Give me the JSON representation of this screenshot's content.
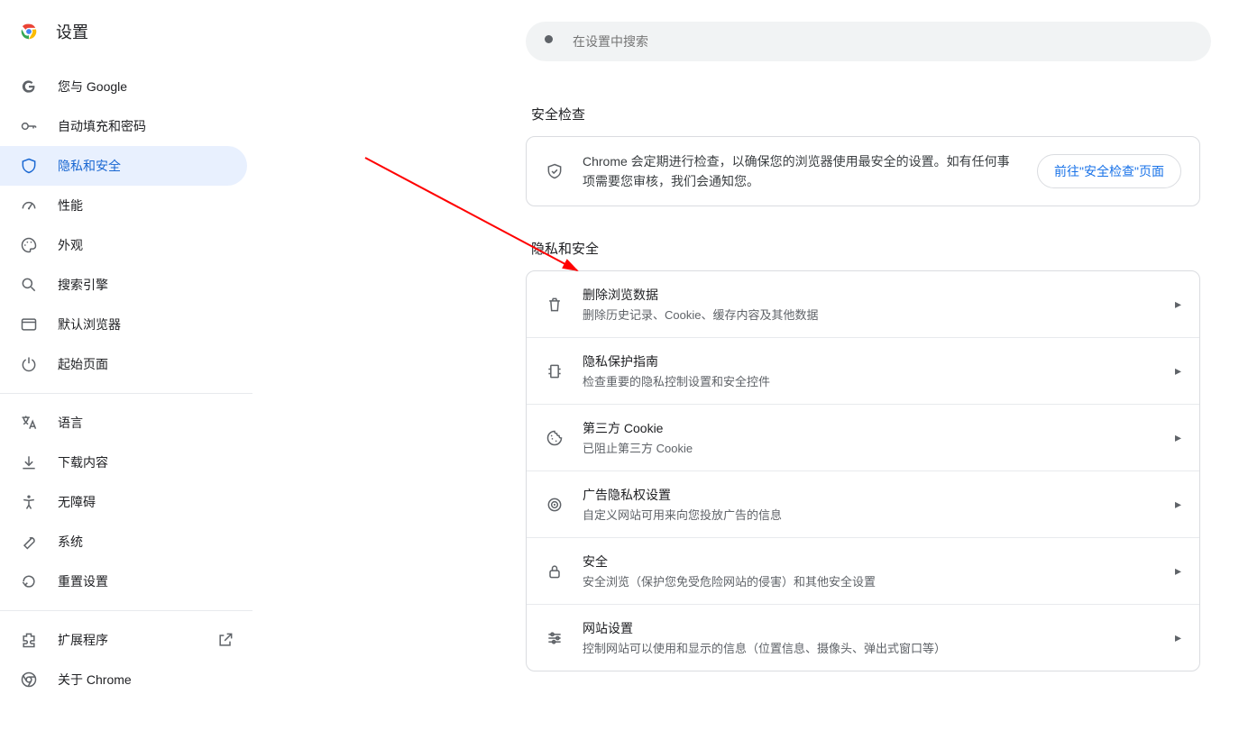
{
  "header": {
    "title": "设置",
    "search_placeholder": "在设置中搜索"
  },
  "sidebar": {
    "groups": [
      [
        {
          "label": "您与 Google",
          "icon": "google"
        },
        {
          "label": "自动填充和密码",
          "icon": "key"
        },
        {
          "label": "隐私和安全",
          "icon": "shield",
          "active": true
        },
        {
          "label": "性能",
          "icon": "speed"
        },
        {
          "label": "外观",
          "icon": "palette"
        },
        {
          "label": "搜索引擎",
          "icon": "search"
        },
        {
          "label": "默认浏览器",
          "icon": "browser"
        },
        {
          "label": "起始页面",
          "icon": "power"
        }
      ],
      [
        {
          "label": "语言",
          "icon": "translate"
        },
        {
          "label": "下载内容",
          "icon": "download"
        },
        {
          "label": "无障碍",
          "icon": "access"
        },
        {
          "label": "系统",
          "icon": "wrench"
        },
        {
          "label": "重置设置",
          "icon": "reset"
        }
      ],
      [
        {
          "label": "扩展程序",
          "icon": "ext",
          "launch": true
        },
        {
          "label": "关于 Chrome",
          "icon": "chrome"
        }
      ]
    ]
  },
  "sections": {
    "safety_title": "安全检查",
    "safety_text": "Chrome 会定期进行检查，以确保您的浏览器使用最安全的设置。如有任何事项需要您审核，我们会通知您。",
    "safety_button": "前往\"安全检查\"页面",
    "privacy_title": "隐私和安全",
    "rows": [
      {
        "title": "删除浏览数据",
        "sub": "删除历史记录、Cookie、缓存内容及其他数据",
        "icon": "trash"
      },
      {
        "title": "隐私保护指南",
        "sub": "检查重要的隐私控制设置和安全控件",
        "icon": "guide"
      },
      {
        "title": "第三方 Cookie",
        "sub": "已阻止第三方 Cookie",
        "icon": "cookie"
      },
      {
        "title": "广告隐私权设置",
        "sub": "自定义网站可用来向您投放广告的信息",
        "icon": "ads"
      },
      {
        "title": "安全",
        "sub": "安全浏览（保护您免受危险网站的侵害）和其他安全设置",
        "icon": "lock"
      },
      {
        "title": "网站设置",
        "sub": "控制网站可以使用和显示的信息（位置信息、摄像头、弹出式窗口等）",
        "icon": "tune"
      }
    ]
  }
}
